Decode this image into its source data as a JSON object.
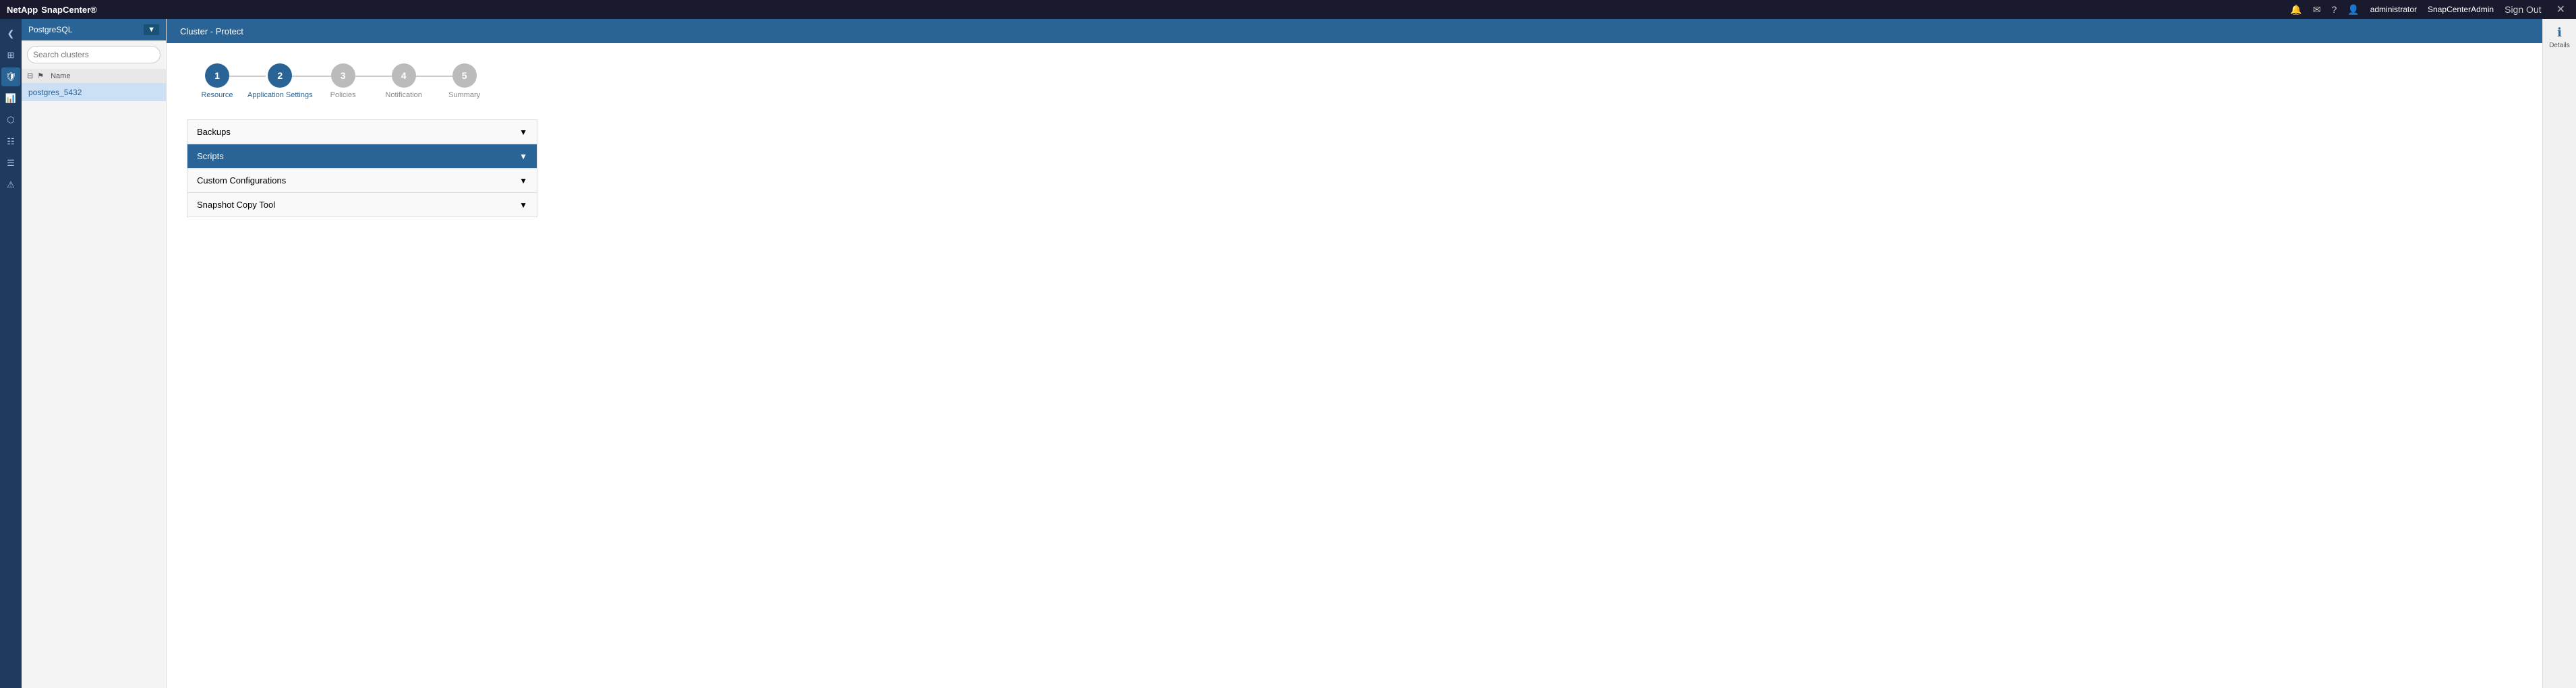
{
  "app": {
    "brand": "NetApp",
    "product": "SnapCenter®"
  },
  "topbar": {
    "right": {
      "bell_label": "🔔",
      "mail_label": "✉",
      "help_label": "?",
      "user_icon": "👤",
      "username": "administrator",
      "instance": "SnapCenterAdmin",
      "signout": "Sign Out",
      "close": "✕"
    }
  },
  "icon_sidebar": {
    "icons": [
      {
        "name": "chevron-icon",
        "symbol": "❮",
        "active": false
      },
      {
        "name": "grid-icon",
        "symbol": "⊞",
        "active": false
      },
      {
        "name": "shield-icon",
        "symbol": "🛡",
        "active": true
      },
      {
        "name": "chart-icon",
        "symbol": "📊",
        "active": false
      },
      {
        "name": "nodes-icon",
        "symbol": "⬡",
        "active": false
      },
      {
        "name": "hierarchy-icon",
        "symbol": "⊶",
        "active": false
      },
      {
        "name": "list-icon",
        "symbol": "☰",
        "active": false
      },
      {
        "name": "alert-icon",
        "symbol": "⚠",
        "active": false
      }
    ]
  },
  "left_panel": {
    "title": "PostgreSQL",
    "dropdown_label": "▼",
    "search_placeholder": "Search clusters",
    "list_columns": [
      "Name"
    ],
    "list_items": [
      {
        "name": "postgres_5432",
        "selected": true
      }
    ]
  },
  "content_header": {
    "breadcrumb": "Cluster - Protect"
  },
  "wizard": {
    "steps": [
      {
        "number": "1",
        "label": "Resource",
        "state": "completed"
      },
      {
        "number": "2",
        "label": "Application Settings",
        "state": "active"
      },
      {
        "number": "3",
        "label": "Policies",
        "state": "inactive"
      },
      {
        "number": "4",
        "label": "Notification",
        "state": "inactive"
      },
      {
        "number": "5",
        "label": "Summary",
        "state": "inactive"
      }
    ],
    "accordion": {
      "items": [
        {
          "label": "Backups",
          "active": false
        },
        {
          "label": "Scripts",
          "active": true
        },
        {
          "label": "Custom Configurations",
          "active": false
        },
        {
          "label": "Snapshot Copy Tool",
          "active": false
        }
      ]
    }
  },
  "details_panel": {
    "icon": "ℹ",
    "label": "Details"
  }
}
